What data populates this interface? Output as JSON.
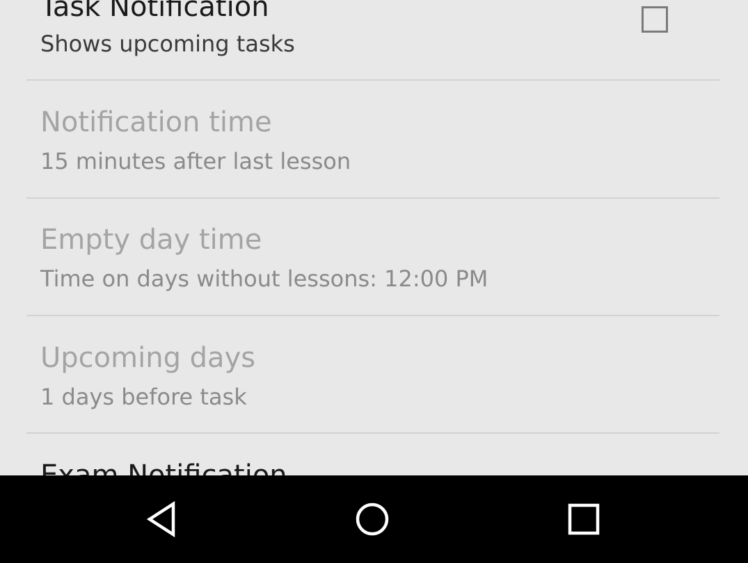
{
  "preferences": {
    "task_notification": {
      "title": "Task Notification",
      "summary": "Shows upcoming tasks",
      "checked": false
    },
    "notification_time": {
      "title": "Notification time",
      "summary": "15 minutes after last lesson",
      "enabled": false
    },
    "empty_day_time": {
      "title": "Empty day time",
      "summary": "Time on days without lessons: 12:00 PM",
      "enabled": false
    },
    "upcoming_days": {
      "title": "Upcoming days",
      "summary": "1 days before task",
      "enabled": false
    },
    "exam_notification": {
      "title": "Exam Notification"
    }
  },
  "navbar": {
    "back_icon": "back-triangle-icon",
    "home_icon": "home-circle-icon",
    "recents_icon": "recents-square-icon"
  },
  "colors": {
    "background": "#e8e8e8",
    "navbar": "#000000",
    "title": "#1a1a1a",
    "disabled_title": "#a4a4a4"
  }
}
